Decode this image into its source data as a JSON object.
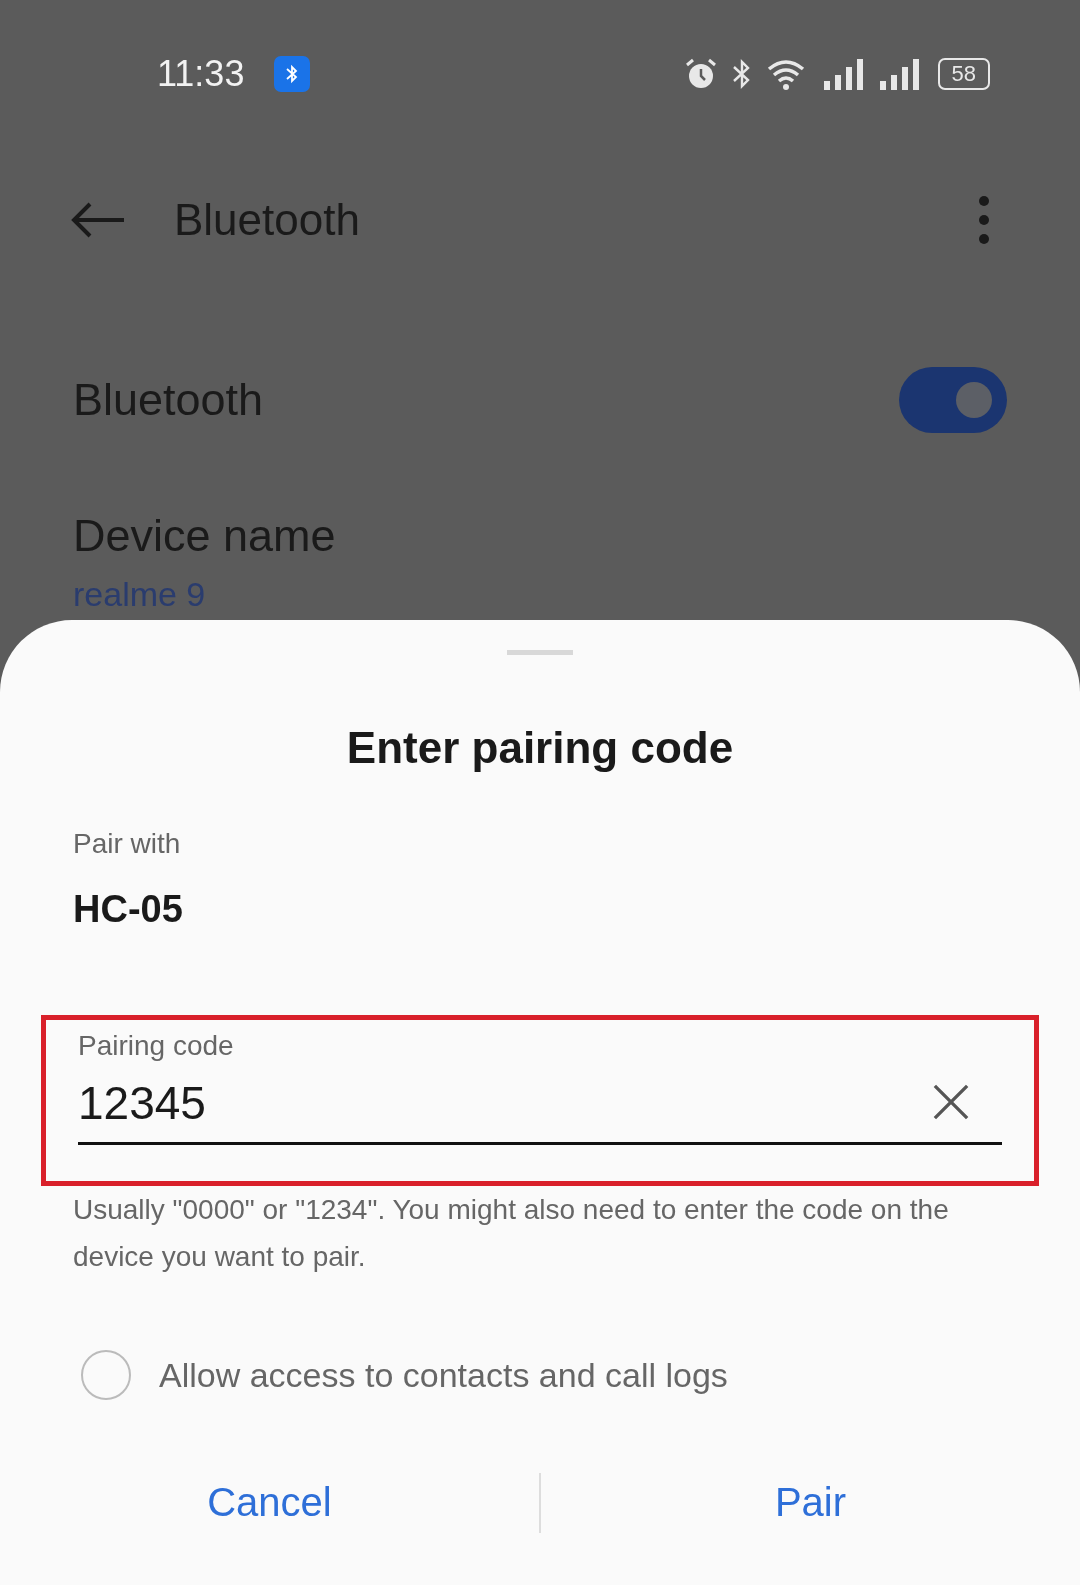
{
  "status_bar": {
    "time": "11:33",
    "battery": "58"
  },
  "app_bar": {
    "title": "Bluetooth"
  },
  "settings": [
    {
      "kind": "switch",
      "label": "Bluetooth",
      "on": true
    },
    {
      "kind": "value",
      "label": "Device name",
      "value": "realme 9"
    }
  ],
  "dialog": {
    "title": "Enter pairing code",
    "pair_with_label": "Pair with",
    "device": "HC-05",
    "field": {
      "label": "Pairing code",
      "value": "12345",
      "highlighted": true
    },
    "helper": "Usually \"0000\" or \"1234\". You might also need to enter the code on the device you want to pair.",
    "checkbox": {
      "label": "Allow access to contacts and call logs",
      "checked": false
    },
    "buttons": [
      "Cancel",
      "Pair"
    ]
  }
}
